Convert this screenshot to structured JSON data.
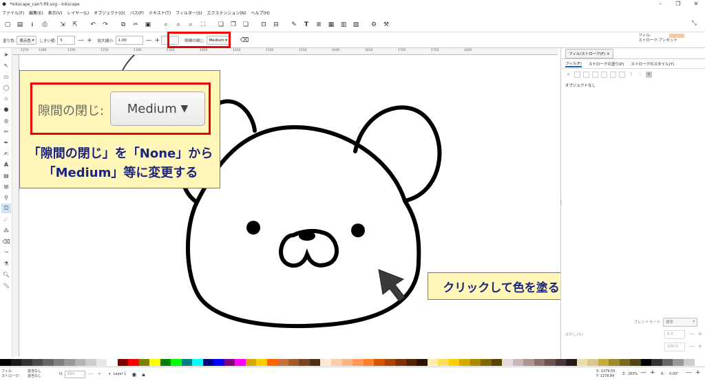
{
  "window": {
    "title": "*Inkscape_can't-fill.svg - Inkscape"
  },
  "menu": [
    "ファイル(F)",
    "編集(E)",
    "表示(V)",
    "レイヤー(L)",
    "オブジェクト(O)",
    "パス(P)",
    "テキスト(T)",
    "フィルター(S)",
    "エクステンション(N)",
    "ヘルプ(H)"
  ],
  "controls": {
    "fill_label": "塗り色:",
    "fill_value": "表示色",
    "threshold_label": "しきい値:",
    "threshold_value": "5",
    "grow_label": "拡大縮小:",
    "grow_value": "1.00",
    "gap_label": "隙間の閉じ:",
    "gap_value": "Medium"
  },
  "style_indicator": {
    "fill_label": "フィル:",
    "stroke_label": "ストローク:",
    "stroke_value": "アンセット",
    "fill_color": "#f8c8a0"
  },
  "ruler_ticks": [
    "1270",
    "1280",
    "1200",
    "1250",
    "1300",
    "1350",
    "1400",
    "1450",
    "1500",
    "1550",
    "1600",
    "1650",
    "1700",
    "1750",
    "1800"
  ],
  "panel": {
    "title": "フィル/ストローク(F)",
    "tabs": [
      "フィル(F)",
      "ストロークの塗り(P)",
      "ストロークのスタイル(Y)"
    ],
    "no_object": "オブジェクトなし",
    "blend_label": "ブレンドモード:",
    "blend_value": "標準",
    "blur_label": "ぼかし(%)",
    "blur_value": "0.0",
    "opacity_value": "100.0"
  },
  "status": {
    "fill_label": "フィル:",
    "fill_value": "該当なし",
    "stroke_label": "ストローク:",
    "stroke_value": "該当なし",
    "opacity_label": "O:",
    "opacity_value": "100",
    "layer": "Layer 1",
    "x_label": "X:",
    "x_value": "1379.50",
    "y_label": "Y:",
    "y_value": "1278.84",
    "zoom_label": "Z:",
    "zoom_value": "283%",
    "rotate_label": "R:",
    "rotate_value": "0.00°"
  },
  "annotation": {
    "zoom_label": "隙間の閉じ:",
    "zoom_value": "Medium",
    "line1": "「隙間の閉じ」を「None」から",
    "line2": "「Medium」等に変更する",
    "click_text": "クリックして色を塗る"
  },
  "palette": [
    "#000000",
    "#1a1a1a",
    "#333333",
    "#4d4d4d",
    "#666666",
    "#808080",
    "#999999",
    "#b3b3b3",
    "#cccccc",
    "#e6e6e6",
    "#ffffff",
    "#800000",
    "#ff0000",
    "#808000",
    "#ffff00",
    "#008000",
    "#00ff00",
    "#008080",
    "#00ffff",
    "#000080",
    "#0000ff",
    "#800080",
    "#ff00ff",
    "#d4aa00",
    "#ffcc00",
    "#ff6600",
    "#c87137",
    "#a05a2c",
    "#784421",
    "#502d16",
    "#ffe6d5",
    "#ffccaa",
    "#ffb380",
    "#ff9955",
    "#ff7f2a",
    "#d45500",
    "#aa4400",
    "#803300",
    "#552200",
    "#2b1100",
    "#ffeeaa",
    "#ffdd55",
    "#ffcc00",
    "#d4aa00",
    "#aa8800",
    "#806600",
    "#554400",
    "#e3dbdb",
    "#c8b7b7",
    "#ac9393",
    "#916f6f",
    "#6c5353",
    "#483737",
    "#241c1c",
    "#e9ddaf",
    "#dbc68b",
    "#c8ab37",
    "#a0892c",
    "#786721",
    "#504416",
    "#000000",
    "#333333",
    "#666666",
    "#999999",
    "#cccccc",
    "#ffffff"
  ]
}
